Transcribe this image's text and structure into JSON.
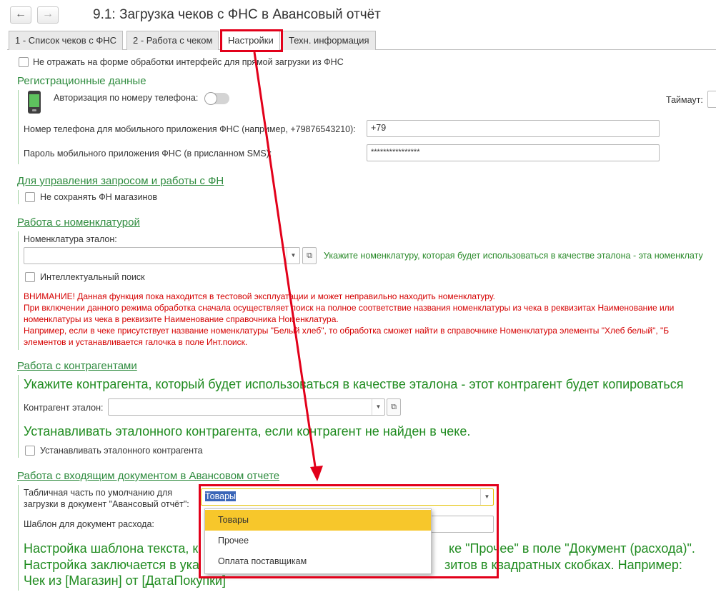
{
  "window": {
    "back_icon": "arrow-left-icon",
    "forward_icon": "arrow-right-icon",
    "title": "9.1: Загрузка чеков с ФНС в Авансовый отчёт"
  },
  "tabs": [
    {
      "label": "1 - Список чеков с ФНС"
    },
    {
      "label": "2 - Работа с чеком"
    },
    {
      "label": "Настройки"
    },
    {
      "label": "Техн. информация"
    }
  ],
  "settings": {
    "hide_interface_label": "Не отражать на форме обработки интерфейс для прямой загрузки из ФНС",
    "registration": {
      "title": "Регистрационные данные",
      "phone_icon": "smartphone-icon",
      "auth_by_phone_label": "Авторизация по номеру телефона:",
      "auth_by_phone_on": false,
      "timeout_label": "Таймаут:",
      "phone_label": "Номер телефона для мобильного приложения ФНС (например, +79876543210):",
      "phone_value": "+79",
      "password_label": "Пароль мобильного приложения ФНС (в присланном SMS):",
      "password_value": "****************"
    },
    "fn": {
      "title": "Для управления запросом и работы с ФН",
      "dont_save_label": "Не сохранять ФН магазинов"
    },
    "nomenclature": {
      "title": "Работа с номенклатурой",
      "etalon_label": "Номенклатура эталон:",
      "etalon_value": "",
      "hint": "Укажите номенклатуру, которая будет использоваться в качестве эталона - эта номенклату",
      "smart_search_label": "Интеллектуальный поиск",
      "warning_lines": [
        "ВНИМАНИЕ! Данная функция пока находится в тестовой эксплуатации и может неправильно находить номенклатуру.",
        "При включении данного режима обработка сначала осуществляет поиск на полное соответствие названия номенклатуры из чека в реквизитах Наименование или",
        "номенклатуры из чека в реквизите Наименование справочника Номенклатура.",
        "Например, если в чеке присутствует название номенклатуры \"Белый хлеб\", то обработка сможет найти в справочнике Номенклатура элементы \"Хлеб белый\", \"Б",
        "элементов и устанавливается галочка в поле Инт.поиск."
      ]
    },
    "counterparties": {
      "title": "Работа с контрагентами",
      "hint_big": "Укажите контрагента, который будет использоваться в качестве эталона - этот контрагент будет копироваться",
      "etalon_label": "Контрагент эталон:",
      "etalon_value": "",
      "set_hint_big": "Устанавливать эталонного контрагента, если контрагент не найден в чеке.",
      "set_etalon_label": "Устанавливать эталонного контрагента"
    },
    "incoming": {
      "title": "Работа с входящим документом в Авансовом отчете",
      "table_part_label_line1": "Табличная часть по умолчанию для",
      "table_part_label_line2": "загрузки в документ \"Авансовый отчёт\":",
      "table_part_value": "Товары",
      "template_label": "Шаблон для документ расхода:",
      "big_lines": [
        "Настройка шаблона текста, к",
        "Настройка заключается в ука",
        "Чек из [Магазин] от [ДатаПокупки]"
      ],
      "big_lines_right": [
        "ке \"Прочее\" в поле \"Документ (расхода)\".",
        "зитов в квадратных скобках. Например:"
      ],
      "dropdown_options": [
        "Товары",
        "Прочее",
        "Оплата поставщикам"
      ],
      "dropdown_selected": "Товары"
    }
  },
  "colors": {
    "accent_green": "#2e8b3e",
    "warning_red": "#d50000",
    "highlight_red": "#e2001a",
    "selection_yellow": "#f7c72b"
  }
}
